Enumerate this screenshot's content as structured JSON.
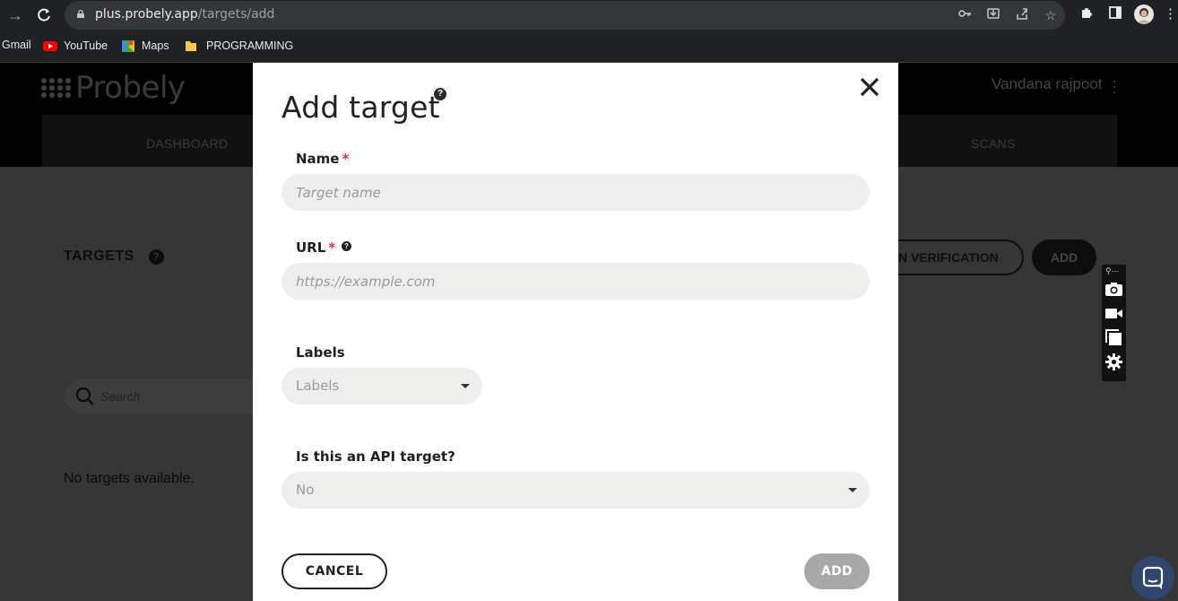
{
  "browser": {
    "url_domain": "plus.probely.app",
    "url_path": "/targets/add",
    "bookmarks": [
      {
        "label": "Gmail"
      },
      {
        "label": "YouTube"
      },
      {
        "label": "Maps"
      },
      {
        "label": "PROGRAMMING"
      }
    ]
  },
  "app": {
    "logo": "Probely",
    "user_name": "Vandana rajpoot",
    "nav": {
      "dashboard": "DASHBOARD",
      "scans": "SCANS"
    },
    "targets_title": "TARGETS",
    "verification_button": "N VERIFICATION",
    "add_button": "ADD",
    "search_placeholder": "Search",
    "empty_message": "No targets available."
  },
  "modal": {
    "title": "Add target",
    "close_symbol": "✕",
    "name": {
      "label": "Name",
      "required_mark": "*",
      "placeholder": "Target name",
      "value": ""
    },
    "url": {
      "label": "URL",
      "required_mark": "*",
      "placeholder": "https://example.com",
      "value": ""
    },
    "labels": {
      "label": "Labels",
      "placeholder": "Labels"
    },
    "api_target": {
      "label": "Is this an API target?",
      "selected": "No"
    },
    "cancel_label": "CANCEL",
    "add_label": "ADD"
  },
  "colors": {
    "required": "#d6323e",
    "add_disabled": "#a8a8a8",
    "input_bg": "#eeeeec",
    "chat_fab": "#31466e"
  }
}
